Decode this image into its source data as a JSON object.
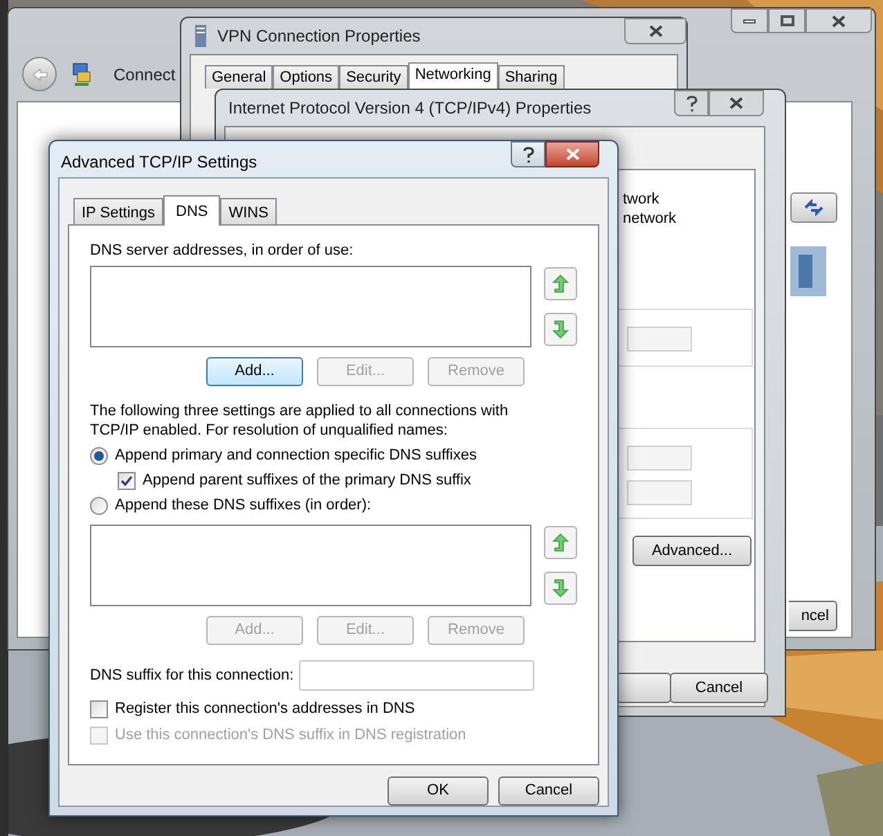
{
  "explorer_window": {
    "address_text": "Connect",
    "button_text": "ncel"
  },
  "vpn_window": {
    "title": "VPN Connection Properties",
    "tabs": [
      {
        "label": "General",
        "selected": false
      },
      {
        "label": "Options",
        "selected": false
      },
      {
        "label": "Security",
        "selected": false
      },
      {
        "label": "Networking",
        "selected": true
      },
      {
        "label": "Sharing",
        "selected": false
      }
    ]
  },
  "ipv4_window": {
    "title": "Internet Protocol Version 4 (TCP/IPv4) Properties",
    "text_lines": [
      "twork",
      "network"
    ],
    "advanced_button": "Advanced...",
    "cancel_button": "Cancel"
  },
  "advanced_window": {
    "title": "Advanced TCP/IP Settings",
    "tabs": [
      {
        "label": "IP Settings",
        "selected": false
      },
      {
        "label": "DNS",
        "selected": true
      },
      {
        "label": "WINS",
        "selected": false
      }
    ],
    "server_list_label": "DNS server addresses, in order of use:",
    "server_buttons": [
      {
        "label": "Add...",
        "disabled": false
      },
      {
        "label": "Edit...",
        "disabled": true
      },
      {
        "label": "Remove",
        "disabled": true
      }
    ],
    "info": "The following three settings are applied to all connections with TCP/IP enabled. For resolution of unqualified names:",
    "suffix_options": [
      {
        "label": "Append primary and connection specific DNS suffixes",
        "selected": true,
        "children": [
          {
            "label": "Append parent suffixes of the primary DNS suffix",
            "checked": true
          }
        ]
      },
      {
        "label": "Append these DNS suffixes (in order):",
        "selected": false
      }
    ],
    "suffix_buttons": [
      {
        "label": "Add...",
        "disabled": true
      },
      {
        "label": "Edit...",
        "disabled": true
      },
      {
        "label": "Remove",
        "disabled": true
      }
    ],
    "suffix_field": {
      "label": "DNS suffix for this connection:"
    },
    "register_options": [
      {
        "label": "Register this connection's addresses in DNS",
        "checked": false,
        "disabled": false
      },
      {
        "label": "Use this connection's DNS suffix in DNS registration",
        "checked": false,
        "disabled": true
      }
    ],
    "buttons": [
      "OK",
      "Cancel"
    ]
  }
}
